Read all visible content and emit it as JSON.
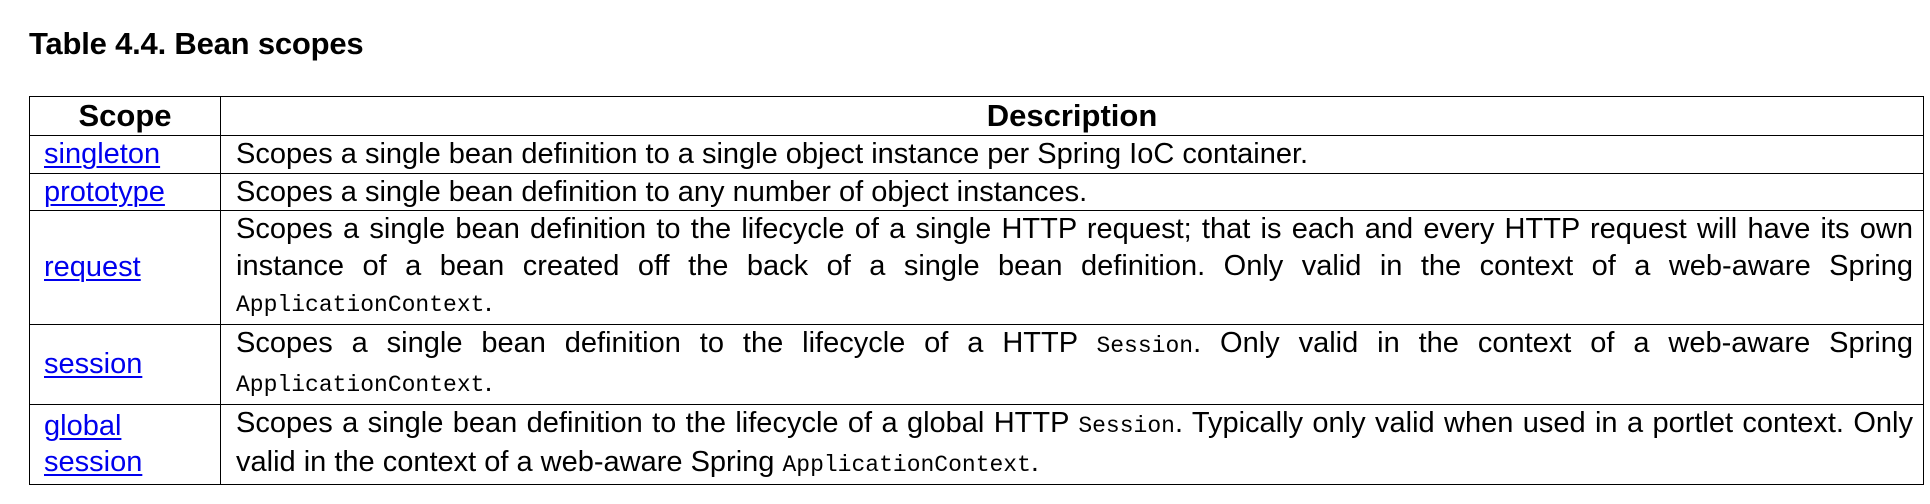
{
  "caption": "Table 4.4. Bean scopes",
  "table": {
    "headers": [
      "Scope",
      "Description"
    ],
    "rows": [
      {
        "scope": "singleton",
        "desc_parts": [
          "Scopes a single bean definition to a single object instance per Spring IoC container."
        ]
      },
      {
        "scope": "prototype",
        "desc_parts": [
          "Scopes a single bean definition to any number of object instances."
        ]
      },
      {
        "scope": "request",
        "desc_parts": [
          "Scopes a single bean definition to the lifecycle of a single HTTP request; that is each and every HTTP request will have its own instance of a bean created off the back of a single bean definition. Only valid in the context of a web-aware Spring ",
          "ApplicationContext",
          "."
        ]
      },
      {
        "scope": "session",
        "desc_parts": [
          "Scopes a single bean definition to the lifecycle of a HTTP ",
          "Session",
          ". Only valid in the context of a web-aware Spring ",
          "ApplicationContext",
          "."
        ]
      },
      {
        "scope": "global session",
        "desc_parts": [
          "Scopes a single bean definition to the lifecycle of a global HTTP ",
          "Session",
          ". Typically only valid when used in a portlet context. Only valid in the context of a web-aware Spring ",
          "ApplicationContext",
          "."
        ]
      }
    ]
  },
  "colors": {
    "link": "#0000ee",
    "border": "#000000"
  }
}
